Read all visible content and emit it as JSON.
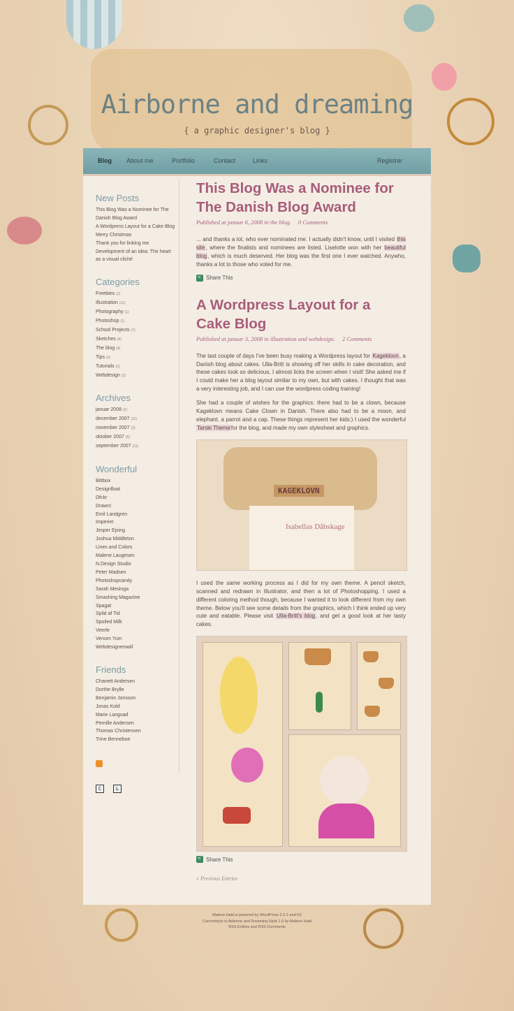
{
  "site": {
    "title": "Airborne and dreaming",
    "subtitle": "{ a graphic designer's blog }"
  },
  "nav": {
    "items": [
      "Blog",
      "About me",
      "Portfolio",
      "Contact",
      "Links"
    ],
    "register": "Registrer"
  },
  "sidebar": {
    "new_posts": {
      "heading": "New Posts",
      "items": [
        "This Blog Was a Nominee for The Danish Blog Award",
        "A Wordpress Layout for a Cake Blog",
        "Merry Christmas",
        "Thank you for linking me",
        "Development of an idea: The heart as a visual cliché"
      ]
    },
    "categories": {
      "heading": "Categories",
      "items": [
        {
          "name": "Freebies",
          "count": "(2)"
        },
        {
          "name": "Illustration",
          "count": "(11)"
        },
        {
          "name": "Photography",
          "count": "(1)"
        },
        {
          "name": "Photoshop",
          "count": "(1)"
        },
        {
          "name": "School Projects",
          "count": "(7)"
        },
        {
          "name": "Sketches",
          "count": "(4)"
        },
        {
          "name": "The blog",
          "count": "(4)"
        },
        {
          "name": "Tips",
          "count": "(2)"
        },
        {
          "name": "Tutorials",
          "count": "(2)"
        },
        {
          "name": "Webdesign",
          "count": "(2)"
        }
      ]
    },
    "archives": {
      "heading": "Archives",
      "items": [
        {
          "name": "januar 2008",
          "count": "(2)"
        },
        {
          "name": "december 2007",
          "count": "(11)"
        },
        {
          "name": "november 2007",
          "count": "(2)"
        },
        {
          "name": "oktober 2007",
          "count": "(5)"
        },
        {
          "name": "september 2007",
          "count": "(11)"
        }
      ]
    },
    "wonderful": {
      "heading": "Wonderful",
      "items": [
        "Bittbox",
        "Designfloat",
        "Dfckr",
        "Drawn!",
        "Emil Landgren",
        "Imperiet",
        "Jesper Ejsing",
        "Joshua Middleton",
        "Lines and Colors",
        "Malene Laugesen",
        "N.Design Studio",
        "Peter Madsen",
        "Photoshopcandy",
        "Sarah Mesinga",
        "Smashing Magazine",
        "Spagat",
        "Spild af Tid",
        "Spoiled Milk",
        "Veerle",
        "Venom Yum",
        "Webdesignerwall"
      ]
    },
    "friends": {
      "heading": "Friends",
      "items": [
        "Chanett Andersen",
        "Dorthe Brylle",
        "Benjamin Jonsson",
        "Jonas Kold",
        "Marie Langvad",
        "Pernille Andersen",
        "Thomas Christensen",
        "Trine Benneboe"
      ]
    },
    "badges": [
      "C",
      "L"
    ]
  },
  "posts": [
    {
      "title": "This Blog Was a Nominee for The Danish Blog Award",
      "meta": "Published at januar 6, 2008 in the blog.",
      "comments": "0 Comments",
      "p1_a": "... and thanks a lot, who ever nominated me. I actually didn't know, until I visited ",
      "p1_link1": "this site",
      "p1_b": ", where the finalists and nominees are listed. Liselotte won with her ",
      "p1_link2": "beautiful blog",
      "p1_c": ", which is much deserved. Her blog was the first one I ever watched. Anywho, thanks a lot to those who voted for me.",
      "share": "Share This"
    },
    {
      "title": "A Wordpress Layout for a Cake Blog",
      "meta": "Published at januar 3, 2008 in illustration and webdesign.",
      "comments": "2 Comments",
      "p1_a": "The last couple of days I've been busy making a Wordpress layout for ",
      "p1_link": "Kageklovn",
      "p1_b": ", a Danish blog about cakes. Ulla-Britt is showing off her skills in cake decoration, and these cakes look so delicious, I almost licks the screen when I visit! She asked me if I could make her a blog layout similar to my own, but with cakes. I thought that was a very interesting job, and I can use the wordpress coding training!",
      "p2_a": "She had a couple of wishes for the graphics: there had to be a clown, because Kageklovn means Cake Clown in Danish. There also had to be a moon, and elephant, a parrot and a cap. These things represent her kids:) I used the wonderful ",
      "p2_link": "Tarski Theme",
      "p2_b": "for the blog, and made my own stylesheet and graphics.",
      "shot_logo": "KAGEKLOVN",
      "shot_title": "Isabellas Dåbskage",
      "p3_a": "I used the same working process as I did for my own theme. A pencil sketch, scanned and redrawn in Illustrator, and then a lot of Photoshopping. I used a different coloring method though, because I wanted it to look different from my own theme. Below you'll see some details from the graphics, which I think ended up very cute and eatable. Please visit ",
      "p3_link": "Ulla-Britt's blog",
      "p3_b": ", and get a good look at her tasty cakes.",
      "share": "Share This"
    }
  ],
  "prev_entries": "« Previous Entries",
  "footer": {
    "line1": "Malene Hald is powered by WordPress 2.2.2 and K2",
    "line2": "Currentstyle is Airborne and Dreaming Style 1.0 by Malene Hald",
    "line3": "RSS Entries and RSS Comments"
  },
  "colors": {
    "accent": "#a75d7a",
    "nav": "#7aa9ad",
    "panel": "#f4ede4",
    "page_bg": "#e9d3b5"
  }
}
